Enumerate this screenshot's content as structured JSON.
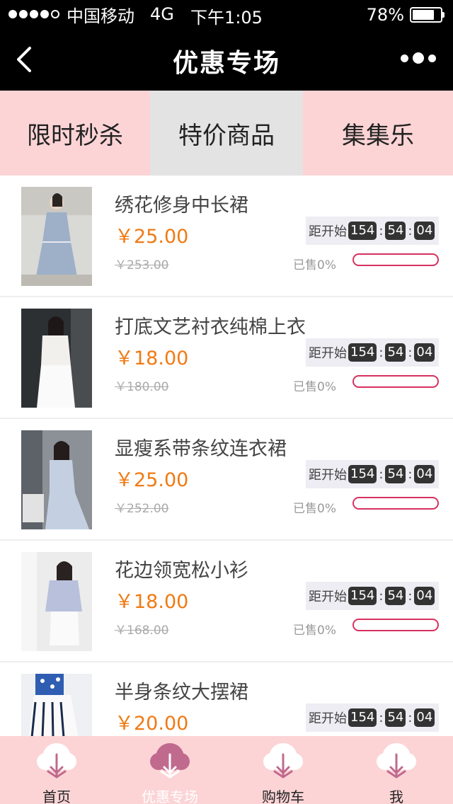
{
  "status_bar": {
    "carrier": "中国移动",
    "network": "4G",
    "time": "下午1:05",
    "battery": "78%",
    "battery_level": 0.78
  },
  "nav": {
    "title": "优惠专场",
    "back_icon": "chevron-left-icon",
    "more_icon": "more-dots-icon"
  },
  "tabs": [
    {
      "label": "限时秒杀"
    },
    {
      "label": "特价商品"
    },
    {
      "label": "集集乐"
    }
  ],
  "countdown_label": "距开始",
  "products": [
    {
      "name": "绣花修身中长裙",
      "price": "￥25.00",
      "original_price": "￥253.00",
      "sold": "已售0%",
      "sold_fraction": 0,
      "countdown": {
        "h": "154",
        "m": "54",
        "s": "04"
      }
    },
    {
      "name": "打底文艺衬衣纯棉上衣",
      "price": "￥18.00",
      "original_price": "￥180.00",
      "sold": "已售0%",
      "sold_fraction": 0,
      "countdown": {
        "h": "154",
        "m": "54",
        "s": "04"
      }
    },
    {
      "name": "显瘦系带条纹连衣裙",
      "price": "￥25.00",
      "original_price": "￥252.00",
      "sold": "已售0%",
      "sold_fraction": 0,
      "countdown": {
        "h": "154",
        "m": "54",
        "s": "04"
      }
    },
    {
      "name": "花边领宽松小衫",
      "price": "￥18.00",
      "original_price": "￥168.00",
      "sold": "已售0%",
      "sold_fraction": 0,
      "countdown": {
        "h": "154",
        "m": "54",
        "s": "04"
      }
    },
    {
      "name": "半身条纹大摆裙",
      "price": "￥20.00",
      "original_price": "",
      "sold": "",
      "sold_fraction": 0,
      "countdown": {
        "h": "154",
        "m": "54",
        "s": "04"
      }
    }
  ],
  "tabbar": [
    {
      "label": "首页",
      "icon": "cotton-flower-icon"
    },
    {
      "label": "优惠专场",
      "icon": "cotton-flower-icon",
      "active": true
    },
    {
      "label": "购物车",
      "icon": "cotton-flower-icon"
    },
    {
      "label": "我",
      "icon": "cotton-flower-icon"
    }
  ],
  "colors": {
    "accent_pink": "#fcd4d6",
    "price_orange": "#f07a14",
    "progress_red": "#d6315f",
    "active_icon": "#c06a8e"
  }
}
